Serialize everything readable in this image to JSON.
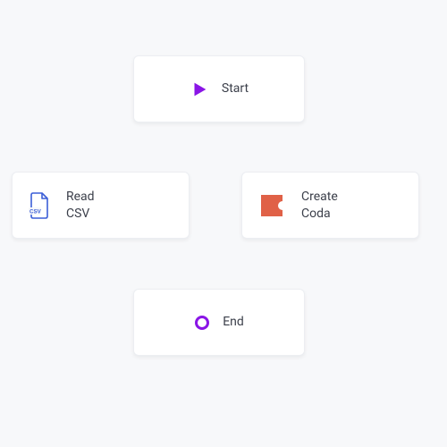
{
  "nodes": {
    "start": {
      "label": "Start"
    },
    "read_csv": {
      "label": "Read\nCSV"
    },
    "create_coda": {
      "label": "Create\nCoda"
    },
    "end": {
      "label": "End"
    }
  },
  "colors": {
    "start_icon": "#8A15E6",
    "csv_icon": "#3C5FD7",
    "coda_icon": "#E06147",
    "end_icon": "#8A15E6"
  }
}
